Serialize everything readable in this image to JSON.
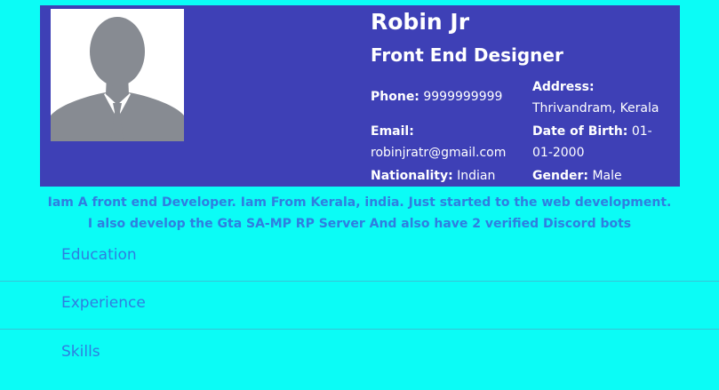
{
  "profile": {
    "name": "Robin Jr",
    "title": "Front End Designer",
    "phone_label": "Phone:",
    "phone": "9999999999",
    "address_label": "Address:",
    "address": "Thrivandram, Kerala",
    "email_label": "Email:",
    "email": "robinjratr@gmail.com",
    "dob_label": "Date of Birth:",
    "dob": "01-01-2000",
    "nationality_label": "Nationality:",
    "nationality": "Indian",
    "gender_label": "Gender:",
    "gender": "Male"
  },
  "bio": {
    "line1": "Iam A front end Developer. Iam From Kerala, india. Just started to the web development.",
    "line2": "I also develop the Gta SA-MP RP Server And also have 2 verified Discord bots"
  },
  "sections": [
    {
      "label": "Education"
    },
    {
      "label": "Experience"
    },
    {
      "label": "Skills"
    }
  ],
  "colors": {
    "page_background": "#0bfcf6",
    "header_background": "#3e40b6",
    "accent_text": "#2f7ee0"
  }
}
